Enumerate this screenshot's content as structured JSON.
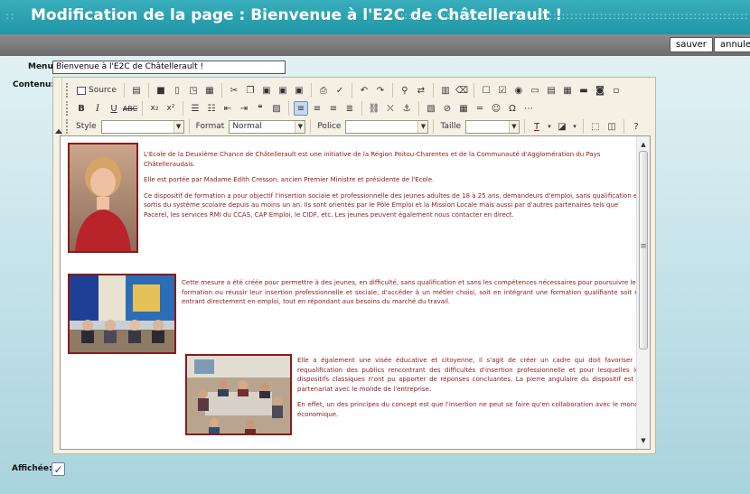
{
  "window": {
    "title": "Modification de la page : Bienvenue à l'E2C de Châtellerault !",
    "dots_left": ":: ",
    "dots_right": "::::::::::::::::::::::::::::::::::::::::::::::::::::::::::::::::::::::::::::::::::::::::::::::::::::"
  },
  "actions": {
    "save_label": "sauver",
    "cancel_label": "annuler"
  },
  "form": {
    "menu_label": "Menu:",
    "menu_value": "Bienvenue à l'E2C de Châtellerault !",
    "content_label": "Contenu:",
    "affichee_label": "Affichée:",
    "affichee_checked": true
  },
  "editor": {
    "source_label": "Source",
    "style_label": "Style",
    "style_value": "",
    "format_label": "Format",
    "format_value": "Normal",
    "font_label": "Police",
    "font_value": "",
    "size_label": "Taille",
    "size_value": ""
  },
  "document": {
    "block1": {
      "p1": "L'Ecole de la Deuxième Chance de Châtellerault est une initiative de la Région Poitou-Charentes et de la Communauté d'Agglomération du Pays Châtelleraudais.",
      "p2": "Elle est portée par Madame Edith Cresson, ancien Premier Ministre et présidente de l'Ecole.",
      "p3": "Ce dispositif de formation a pour objectif l'insertion sociale et professionnelle des jeunes adultes de 18 à 25 ans, demandeurs d'emploi, sans qualification et sortis du système scolaire depuis au moins un an. Ils sont orientés par le Pôle Emploi et la Mission Locale mais aussi par d'autres partenaires tels que Pacerel, les services RMI du CCAS, CAP Emploi, le CIDF, etc. Les jeunes peuvent également nous contacter en direct."
    },
    "block2": {
      "p1": "Cette mesure a été créée pour permettre à des jeunes, en difficulté, sans qualification et sans les compétences nécessaires pour poursuivre leur formation ou réussir leur insertion professionnelle et sociale, d'accéder à un métier choisi, soit en intégrant une formation qualifiante soit en entrant directement en emploi, tout en répondant aux besoins du marché du travail."
    },
    "block3": {
      "p1": "Elle a également une visée éducative et citoyenne, il s'agit de créer un cadre qui doit favoriser la requalification des publics rencontrant des difficultés d'insertion professionnelle et pour lesquelles les dispositifs classiques n'ont pu apporter de réponses concluantes. La pierre angulaire du dispositif est le partenariat avec le monde de l'entreprise.",
      "p2": "En effet, un des principes du concept est que l'insertion ne peut se faire qu'en collaboration avec le monde économique."
    }
  },
  "colors": {
    "title_bar": "#1f96a6",
    "action_bar": "#7a7a7a",
    "body_text": "#8a1a1a",
    "image_border": "#8a1a1a"
  }
}
